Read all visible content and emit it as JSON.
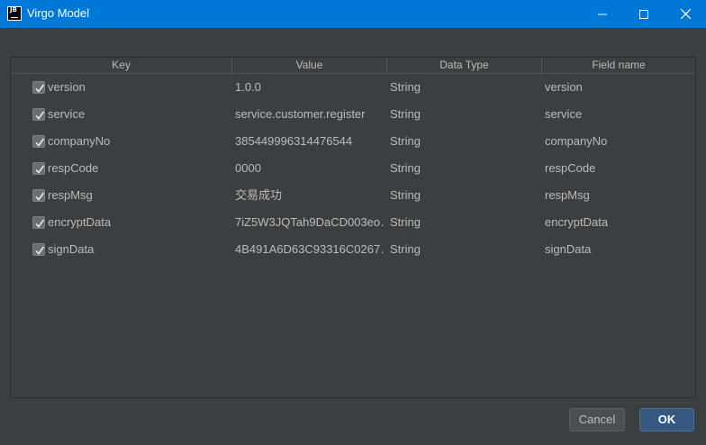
{
  "window": {
    "title": "Virgo Model",
    "app_icon_text": "JB"
  },
  "table": {
    "columns": [
      "Key",
      "Value",
      "Data Type",
      "Field name"
    ],
    "rows": [
      {
        "checked": true,
        "key": "version",
        "value": "1.0.0",
        "type": "String",
        "field": "version"
      },
      {
        "checked": true,
        "key": "service",
        "value": "service.customer.register",
        "type": "String",
        "field": "service"
      },
      {
        "checked": true,
        "key": "companyNo",
        "value": "385449996314476544",
        "type": "String",
        "field": "companyNo"
      },
      {
        "checked": true,
        "key": "respCode",
        "value": "0000",
        "type": "String",
        "field": "respCode"
      },
      {
        "checked": true,
        "key": "respMsg",
        "value": "交易成功",
        "type": "String",
        "field": "respMsg"
      },
      {
        "checked": true,
        "key": "encryptData",
        "value": "7iZ5W3JQTah9DaCD003eo…",
        "type": "String",
        "field": "encryptData"
      },
      {
        "checked": true,
        "key": "signData",
        "value": "4B491A6D63C93316C0267…",
        "type": "String",
        "field": "signData"
      }
    ]
  },
  "buttons": {
    "cancel": "Cancel",
    "ok": "OK"
  },
  "colors": {
    "titlebar": "#0078d7",
    "background": "#3c3f41",
    "ok_button": "#365880"
  }
}
